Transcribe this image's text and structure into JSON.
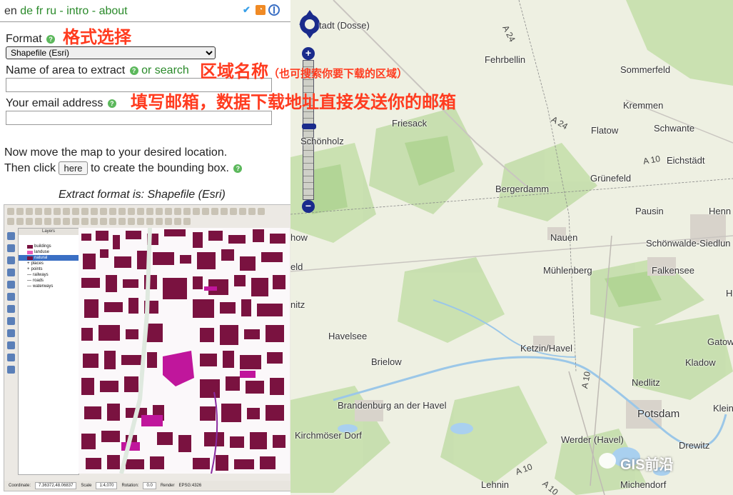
{
  "lang_links": [
    "en",
    "de",
    "fr",
    "ru",
    "-",
    "intro",
    "-",
    "about"
  ],
  "topbar_icons": [
    "twitter-icon",
    "rss-icon",
    "compass-icon"
  ],
  "form": {
    "format_label": "Format",
    "format_selected": "Shapefile (Esri)",
    "area_label": "Name of area to extract",
    "area_search_link": "or search",
    "area_value": "",
    "email_label": "Your email address",
    "email_value": ""
  },
  "annotations": {
    "format": "格式选择",
    "area_big": "区域名称",
    "area_small": "（也可搜索你要下载的区域）",
    "email": "填写邮箱，数据下载地址直接发送你的邮箱"
  },
  "instructions": {
    "line1": "Now move the map to your desired location.",
    "line2_pre": "Then click",
    "here_button": "here",
    "line2_post": "to create the bounding box."
  },
  "extract_format_text": "Extract format is: Shapefile (Esri)",
  "qgis": {
    "layers_title": "Layers",
    "layers": [
      {
        "name": "buildings",
        "color": "#7a1240"
      },
      {
        "name": "landuse",
        "color": "#e85ab8"
      },
      {
        "name": "natural",
        "color": "#7a1240"
      },
      {
        "name": "places",
        "color": ""
      },
      {
        "name": "points",
        "color": ""
      },
      {
        "name": "railways",
        "color": ""
      },
      {
        "name": "roads",
        "color": ""
      },
      {
        "name": "waterways",
        "color": ""
      }
    ],
    "status": {
      "coordinate_label": "Coordinate:",
      "coordinate_value": "7.36372,48.06837",
      "scale_label": "Scale",
      "scale_value": "1:4,070",
      "rotation_label": "Rotation:",
      "rotation_value": "0.0",
      "render_label": "Render",
      "crs": "EPSG:4326"
    }
  },
  "map": {
    "places": [
      {
        "name": "tadt (Dosse)"
      },
      {
        "name": "Fehrbellin"
      },
      {
        "name": "Sommerfeld"
      },
      {
        "name": "Kremmen"
      },
      {
        "name": "Friesack"
      },
      {
        "name": "Flatow"
      },
      {
        "name": "Schwante"
      },
      {
        "name": "Schönholz"
      },
      {
        "name": "Eichstädt"
      },
      {
        "name": "Grünefeld"
      },
      {
        "name": "Bergerdamm"
      },
      {
        "name": "Pausin"
      },
      {
        "name": "Henn"
      },
      {
        "name": "how"
      },
      {
        "name": "Nauen"
      },
      {
        "name": "Schönwalde-Siedlun"
      },
      {
        "name": "eld"
      },
      {
        "name": "Mühlenberg"
      },
      {
        "name": "Falkensee"
      },
      {
        "name": "H"
      },
      {
        "name": "nitz"
      },
      {
        "name": "Havelsee"
      },
      {
        "name": "Ketzin/Havel"
      },
      {
        "name": "Gatow"
      },
      {
        "name": "Brielow"
      },
      {
        "name": "Kladow"
      },
      {
        "name": "Nedlitz"
      },
      {
        "name": "Brandenburg an der Havel"
      },
      {
        "name": "Potsdam"
      },
      {
        "name": "Klein"
      },
      {
        "name": "Kirchmöser Dorf"
      },
      {
        "name": "Werder (Havel)"
      },
      {
        "name": "Drewitz"
      },
      {
        "name": "Lehnin"
      },
      {
        "name": "Michendorf"
      }
    ],
    "road_labels": [
      "A 24",
      "A 24",
      "A 10",
      "A 10",
      "A 10",
      "A 10"
    ],
    "watermark": "GIS前沿"
  }
}
